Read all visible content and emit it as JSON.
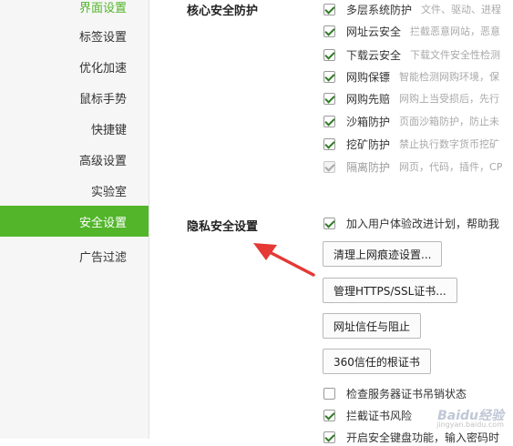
{
  "sidebar": {
    "items": [
      {
        "label": "界面设置"
      },
      {
        "label": "标签设置"
      },
      {
        "label": "优化加速"
      },
      {
        "label": "鼠标手势"
      },
      {
        "label": "快捷键"
      },
      {
        "label": "高级设置"
      },
      {
        "label": "实验室"
      },
      {
        "label": "安全设置",
        "active": true
      },
      {
        "label": "广告过滤"
      }
    ]
  },
  "core": {
    "title": "核心安全防护",
    "options": [
      {
        "label": "多层系统防护",
        "desc": "文件、驱动、进程",
        "checked": true
      },
      {
        "label": "网址云安全",
        "desc": "拦截恶意网站，恶意",
        "checked": true
      },
      {
        "label": "下载云安全",
        "desc": "下载文件安全性检测",
        "checked": true
      },
      {
        "label": "网购保镖",
        "desc": "智能检测网购环境，保",
        "checked": true
      },
      {
        "label": "网购先赔",
        "desc": "网购上当受损后，先行",
        "checked": true
      },
      {
        "label": "沙箱防护",
        "desc": "页面沙箱防护，防止未",
        "checked": true
      },
      {
        "label": "挖矿防护",
        "desc": "禁止执行数字货币挖矿",
        "checked": true
      },
      {
        "label": "隔离防护",
        "desc": "网页，代码，插件，CP",
        "checked": true,
        "disabled": true
      }
    ]
  },
  "privacy": {
    "title": "隐私安全设置",
    "experience_label": "加入用户体验改进计划，帮助我",
    "buttons": {
      "clear": "清理上网痕迹设置...",
      "https": "管理HTTPS/SSL证书...",
      "trust": "网址信任与阻止",
      "root": "360信任的根证书"
    },
    "check_revocation": "检查服务器证书吊销状态",
    "block_cert_risk": "拦截证书风险",
    "secure_keyboard": "开启安全键盘功能，输入密码时"
  },
  "colors": {
    "accent": "#52b52a",
    "arrow": "#e53935"
  },
  "watermark": {
    "main": "Baidu经验",
    "sub": "jingyan.baidu.com"
  }
}
